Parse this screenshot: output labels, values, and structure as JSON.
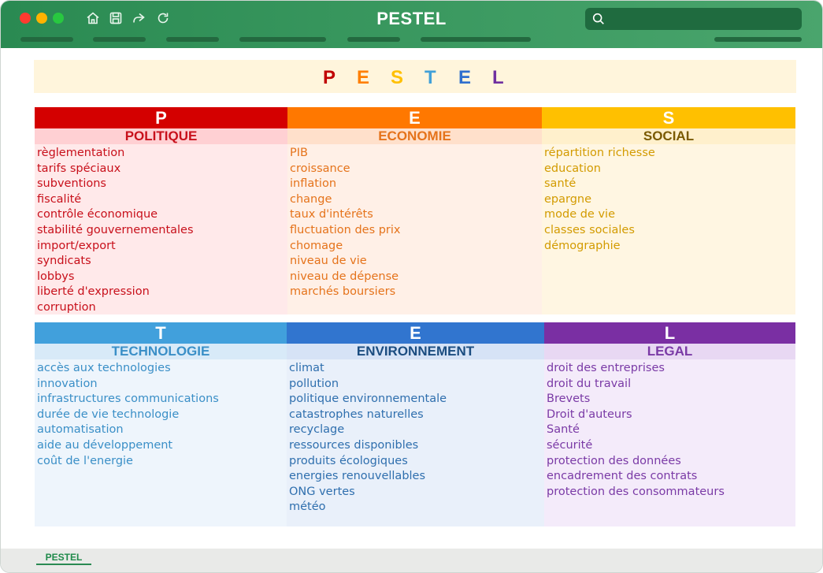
{
  "window": {
    "title": "PESTEL"
  },
  "search": {
    "placeholder": ""
  },
  "banner": {
    "letters": [
      {
        "char": "P",
        "color": "#c00000"
      },
      {
        "char": "E",
        "color": "#ff7f00"
      },
      {
        "char": "S",
        "color": "#ffc000"
      },
      {
        "char": "T",
        "color": "#41a0d8"
      },
      {
        "char": "E",
        "color": "#2f6fce"
      },
      {
        "char": "L",
        "color": "#7030a0"
      }
    ]
  },
  "sections": [
    {
      "letter": "P",
      "category": "POLITIQUE",
      "header_color": "#d40000",
      "cat_bg": "#ffd0d3",
      "body_bg": "#ffe9ea",
      "text_color": "#c8101b",
      "items": [
        "règlementation",
        "tarifs spéciaux",
        "subventions",
        "fiscalité",
        "contrôle économique",
        "stabilité gouvernementales",
        "import/export",
        "syndicats",
        "lobbys",
        "liberté d'expression",
        "corruption"
      ]
    },
    {
      "letter": "E",
      "category": "ECONOMIE",
      "header_color": "#ff7800",
      "cat_bg": "#ffe0cb",
      "body_bg": "#fff0e7",
      "text_color": "#e5731b",
      "items": [
        "PIB",
        "croissance",
        "inflation",
        "change",
        "taux d'intérêts",
        "fluctuation des prix",
        "chomage",
        "niveau de vie",
        "niveau de dépense",
        "marchés boursiers"
      ]
    },
    {
      "letter": "S",
      "category": "SOCIAL",
      "header_color": "#ffc000",
      "cat_bg": "#fff0cc",
      "body_bg": "#fff6e2",
      "text_color": "#d39b00",
      "cat_text_color": "#7a5a00",
      "items": [
        "répartition richesse",
        "education",
        "santé",
        "epargne",
        "mode de vie",
        "classes sociales",
        "démographie"
      ]
    },
    {
      "letter": "T",
      "category": "TECHNOLOGIE",
      "header_color": "#41a0dc",
      "cat_bg": "#d8eaf8",
      "body_bg": "#eef5fc",
      "text_color": "#3a8fc7",
      "items": [
        "accès aux technologies",
        "innovation",
        "infrastructures communications",
        "durée de vie technologie",
        "automatisation",
        "aide au développement",
        "coût de l'energie"
      ]
    },
    {
      "letter": "E",
      "category": "ENVIRONNEMENT",
      "header_color": "#3175cf",
      "cat_bg": "#d6e3f6",
      "body_bg": "#e9f0fa",
      "text_color": "#2f6fae",
      "cat_text_color": "#1b4d80",
      "items": [
        "climat",
        "pollution",
        "politique environnementale",
        "catastrophes naturelles",
        "recyclage",
        "ressources disponibles",
        "produits écologiques",
        "energies renouvellables",
        "ONG vertes",
        "météo"
      ]
    },
    {
      "letter": "L",
      "category": "LEGAL",
      "header_color": "#7a2fa3",
      "cat_bg": "#e8d8f3",
      "body_bg": "#f4ebfa",
      "text_color": "#7a3aa6",
      "items": [
        "droit des entreprises",
        "droit du travail",
        "Brevets",
        "Droit d'auteurs",
        "Santé",
        "sécurité",
        "protection des données",
        "encadrement des contrats",
        "protection des consommateurs"
      ]
    }
  ],
  "footer": {
    "sheet_tab": "PESTEL"
  }
}
